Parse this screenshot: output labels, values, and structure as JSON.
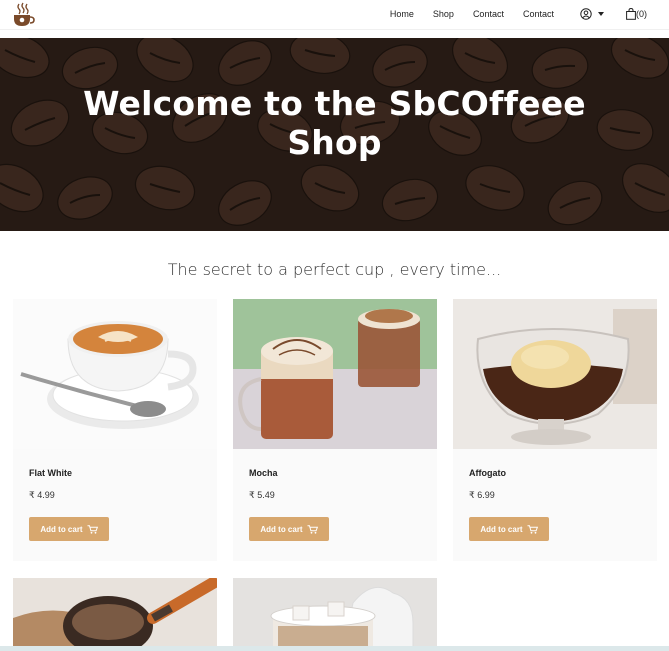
{
  "nav": {
    "logo_icon": "coffee-cup-logo-icon",
    "links": [
      "Home",
      "Shop",
      "Contact",
      "Contact"
    ],
    "user_icon": "user-circle-icon",
    "cart_icon": "shopping-bag-icon",
    "cart_count": "(0)"
  },
  "hero": {
    "title_line1": "Welcome to the SbCOffeee",
    "title_line2": "Shop"
  },
  "tagline": "The secret to a perfect cup , every time...",
  "products": [
    {
      "name": "Flat White",
      "price": "₹ 4.99",
      "button": "Add to cart",
      "image": "flat-white-photo"
    },
    {
      "name": "Mocha",
      "price": "₹ 5.49",
      "button": "Add to cart",
      "image": "mocha-photo"
    },
    {
      "name": "Affogato",
      "price": "₹ 6.99",
      "button": "Add to cart",
      "image": "affogato-photo"
    },
    {
      "name": "",
      "price": "",
      "button": "",
      "image": "turkish-coffee-photo"
    },
    {
      "name": "",
      "price": "",
      "button": "",
      "image": "iced-coffee-photo"
    }
  ],
  "colors": {
    "accent": "#d7a76e",
    "hero_overlay": "#2b1d16",
    "card_bg": "#fafafa"
  }
}
